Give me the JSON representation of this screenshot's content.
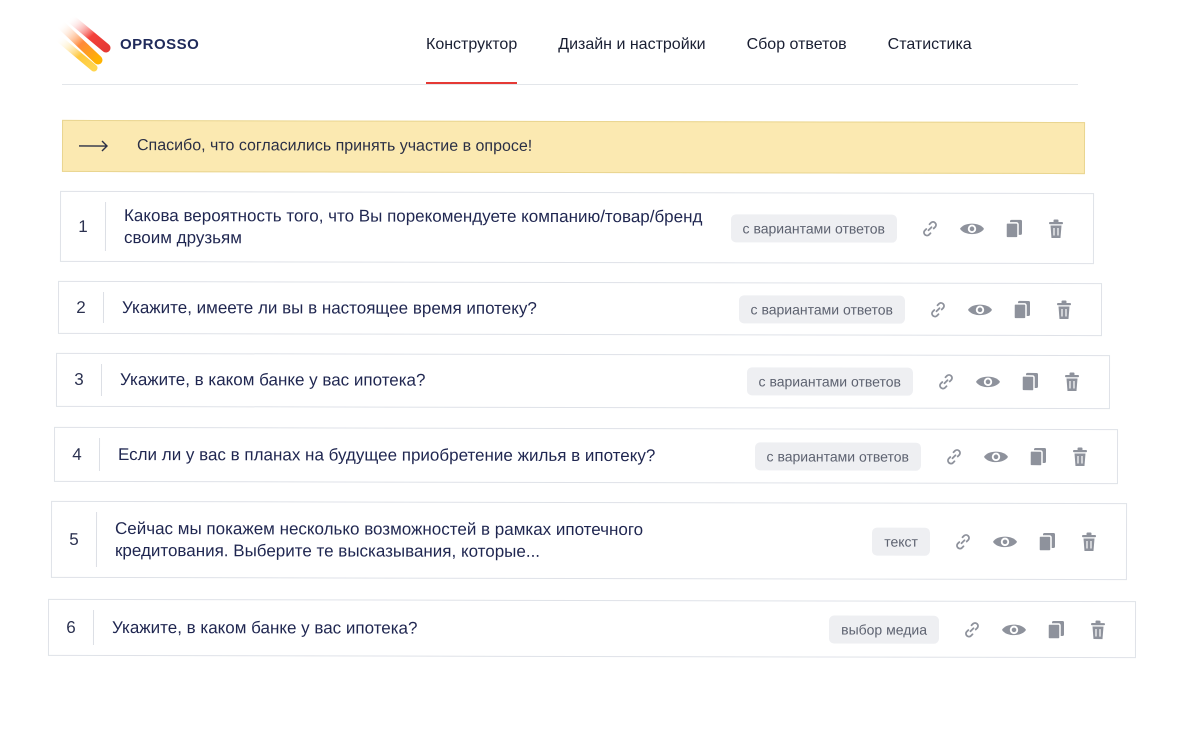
{
  "app": {
    "logo_text": "OPROSSO"
  },
  "nav": [
    {
      "label": "Конструктор",
      "active": true
    },
    {
      "label": "Дизайн и настройки",
      "active": false
    },
    {
      "label": "Сбор ответов",
      "active": false
    },
    {
      "label": "Статистика",
      "active": false
    }
  ],
  "welcome": {
    "text": "Спасибо, что согласились принять участие в опросе!"
  },
  "questions": [
    {
      "num": "1",
      "text": "Какова вероятность того, что Вы порекомендуете компанию/товар/бренд своим друзьям",
      "type": "с вариантами ответов"
    },
    {
      "num": "2",
      "text": "Укажите, имеете ли вы в настоящее время ипотеку?",
      "type": "с вариантами ответов"
    },
    {
      "num": "3",
      "text": "Укажите, в каком банке у вас ипотека?",
      "type": "с вариантами ответов"
    },
    {
      "num": "4",
      "text": "Если ли у вас в планах на будущее приобретение жилья в ипотеку?",
      "type": "с вариантами ответов"
    },
    {
      "num": "5",
      "text": "Сейчас мы покажем несколько возможностей в рамках ипотечного кредитования. Выберите те высказывания, которые...",
      "type": "текст"
    },
    {
      "num": "6",
      "text": "Укажите, в каком банке у вас ипотека?",
      "type": "выбор медиа"
    }
  ],
  "icons": {
    "link": "link-icon",
    "preview": "eye-icon",
    "copy": "copy-icon",
    "delete": "trash-icon"
  },
  "colors": {
    "accent": "#e53935",
    "welcome_bg": "#fbe9b1",
    "icon": "#8e929c"
  }
}
